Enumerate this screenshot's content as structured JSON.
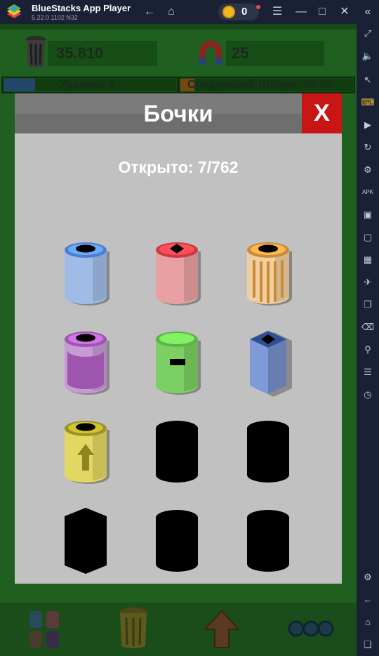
{
  "emulator": {
    "app_name": "BlueStacks App Player",
    "version": "5.22.0.1102  N32",
    "coin_count": "0"
  },
  "hud": {
    "trash_value": "35.810",
    "magnet_value": "25",
    "level_label": "Уровень 2",
    "storm_label": "Следующий Шторм: 05:28"
  },
  "modal": {
    "title": "Бочки",
    "close_label": "X",
    "opened_label": "Открыто: 7/762"
  },
  "barrels": [
    {
      "name": "blue-barrel-icon",
      "unlocked": true,
      "body": "#a0bce6",
      "rim": "#4f7ed0"
    },
    {
      "name": "pink-barrel-icon",
      "unlocked": true,
      "body": "#e8a0a2",
      "rim": "#cc3a44"
    },
    {
      "name": "striped-barrel-icon",
      "unlocked": true,
      "body": "#f0cf9e",
      "rim": "#c98a3a"
    },
    {
      "name": "purple-barrel-icon",
      "unlocked": true,
      "body": "#9d55ad",
      "rim": "#c59ad6"
    },
    {
      "name": "green-barrel-icon",
      "unlocked": true,
      "body": "#7ccf62",
      "rim": "#5fb34a"
    },
    {
      "name": "blue-box-bin-icon",
      "unlocked": true,
      "body": "#7f9ad8",
      "rim": "#2f4f96"
    },
    {
      "name": "yellow-arrow-barrel-icon",
      "unlocked": true,
      "body": "#e2d762",
      "rim": "#9c9125"
    },
    {
      "name": "locked-barrel-icon",
      "unlocked": false
    },
    {
      "name": "locked-barrel-icon",
      "unlocked": false
    },
    {
      "name": "locked-hex-barrel-icon",
      "unlocked": false
    },
    {
      "name": "locked-barrel-icon",
      "unlocked": false
    },
    {
      "name": "locked-barrel-icon",
      "unlocked": false
    }
  ],
  "colors": {
    "modal_bg": "#c1c1c1",
    "close_red": "#c81616",
    "game_green": "#1f5f1f"
  }
}
